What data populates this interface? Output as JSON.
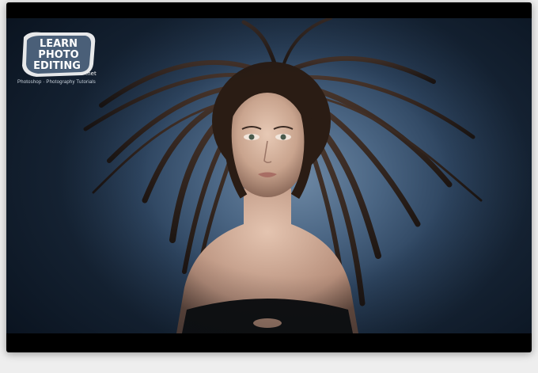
{
  "watermark": {
    "line1": "LEARN",
    "line2": "PHOTO",
    "line3": "EDITING",
    "suffix": ".net",
    "tagline": "Photoshop · Photography Tutorials"
  },
  "photo": {
    "subject": "woman-with-windblown-hair",
    "colors": {
      "background": "#4b6684",
      "hair": "#2a1c14",
      "skin": "#c9a48e",
      "dress": "#111111"
    }
  }
}
